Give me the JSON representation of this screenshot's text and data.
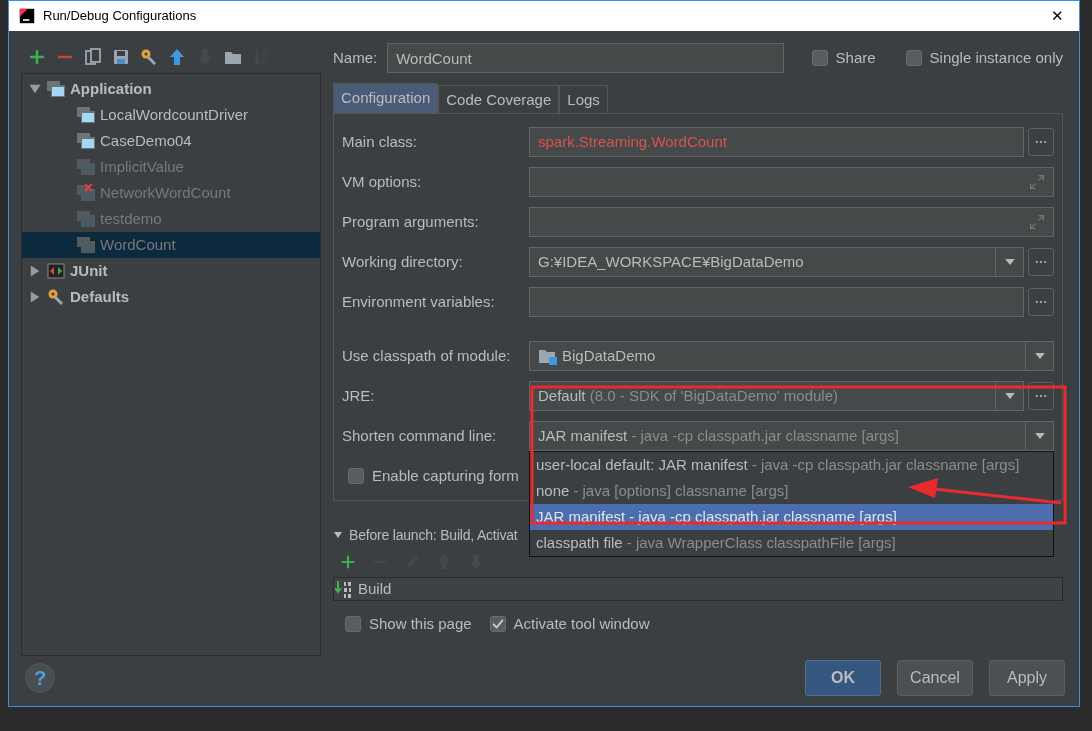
{
  "window": {
    "title": "Run/Debug Configurations",
    "close": "✕"
  },
  "toolbar": [
    {
      "kind": "add",
      "disabled": false
    },
    {
      "kind": "remove",
      "disabled": false
    },
    {
      "kind": "copy",
      "disabled": false
    },
    {
      "kind": "save",
      "disabled": false
    },
    {
      "kind": "defaults",
      "disabled": false
    },
    {
      "kind": "up",
      "disabled": false
    },
    {
      "kind": "down",
      "disabled": true
    },
    {
      "kind": "folder",
      "disabled": false
    },
    {
      "kind": "sort",
      "disabled": true
    }
  ],
  "tree": [
    {
      "label": "Application",
      "kind": "application",
      "expanded": true,
      "children": [
        {
          "label": "LocalWordcountDriver",
          "disabled": false,
          "error": false,
          "selected": false
        },
        {
          "label": "CaseDemo04",
          "disabled": false,
          "error": false,
          "selected": false
        },
        {
          "label": "ImplicitValue",
          "disabled": true,
          "error": false,
          "selected": false
        },
        {
          "label": "NetworkWordCount",
          "disabled": true,
          "error": true,
          "selected": false
        },
        {
          "label": "testdemo",
          "disabled": true,
          "error": false,
          "selected": false
        },
        {
          "label": "WordCount",
          "disabled": true,
          "error": false,
          "selected": true
        }
      ]
    },
    {
      "label": "JUnit",
      "kind": "junit",
      "expanded": false
    },
    {
      "label": "Defaults",
      "kind": "defaults",
      "expanded": false
    }
  ],
  "help_button": "?",
  "name": {
    "label": "Name:",
    "value": "WordCount"
  },
  "options": [
    {
      "label": "Share",
      "checked": false
    },
    {
      "label": "Single instance only",
      "checked": false
    }
  ],
  "tabs": [
    {
      "label": "Configuration",
      "selected": true
    },
    {
      "label": "Code Coverage",
      "selected": false
    },
    {
      "label": "Logs",
      "selected": false
    }
  ],
  "form": [
    {
      "kind": "text",
      "label": "Main class:",
      "value": "spark.Streaming.WordCount",
      "invalid": true
    },
    {
      "kind": "expandable",
      "label": "VM options:"
    },
    {
      "kind": "expandable",
      "label": "Program arguments:"
    },
    {
      "kind": "combo",
      "label": "Working directory:",
      "value": "G:¥IDEA_WORKSPACE¥BigDataDemo",
      "browse": true
    },
    {
      "kind": "text",
      "label": "Environment variables:"
    },
    {
      "kind": "module",
      "label": "Use classpath of module:",
      "value": "BigDataDemo"
    },
    {
      "kind": "combo",
      "label": "JRE:",
      "value": "Default",
      "detail": "(8.0 - SDK of 'BigDataDemo' module)",
      "browse": true
    },
    {
      "kind": "combo",
      "label": "Shorten command line:",
      "value": "JAR manifest",
      "detail": "- java -cp classpath.jar classname [args]",
      "open": true,
      "choices": [
        {
          "name": "user-local default: JAR manifest",
          "detail": "- java -cp classpath.jar classname [args]",
          "selected": false
        },
        {
          "name": "none",
          "detail": "- java [options] classname [args]",
          "selected": false
        },
        {
          "name": "JAR manifest",
          "detail": "- java -cp classpath.jar classname [args]",
          "selected": true
        },
        {
          "name": "classpath file",
          "detail": "- java WrapperClass classpathFile [args]",
          "selected": false
        }
      ]
    },
    {
      "kind": "checkbox",
      "label": "Enable capturing form",
      "checked": false
    }
  ],
  "before_launch": {
    "label": "Before launch: Build, Activat",
    "expanded": true,
    "toolbar": [
      {
        "kind": "add",
        "disabled": false
      },
      {
        "kind": "remove",
        "disabled": true
      },
      {
        "kind": "edit",
        "disabled": true
      },
      {
        "kind": "up",
        "disabled": true
      },
      {
        "kind": "down",
        "disabled": true
      }
    ],
    "tasks": [
      "Build"
    ]
  },
  "launch_options": [
    {
      "label": "Show this page",
      "checked": false
    },
    {
      "label": "Activate tool window",
      "checked": true
    }
  ],
  "buttons": [
    {
      "label": "OK",
      "default": true
    },
    {
      "label": "Cancel",
      "default": false
    },
    {
      "label": "Apply",
      "default": false
    }
  ]
}
